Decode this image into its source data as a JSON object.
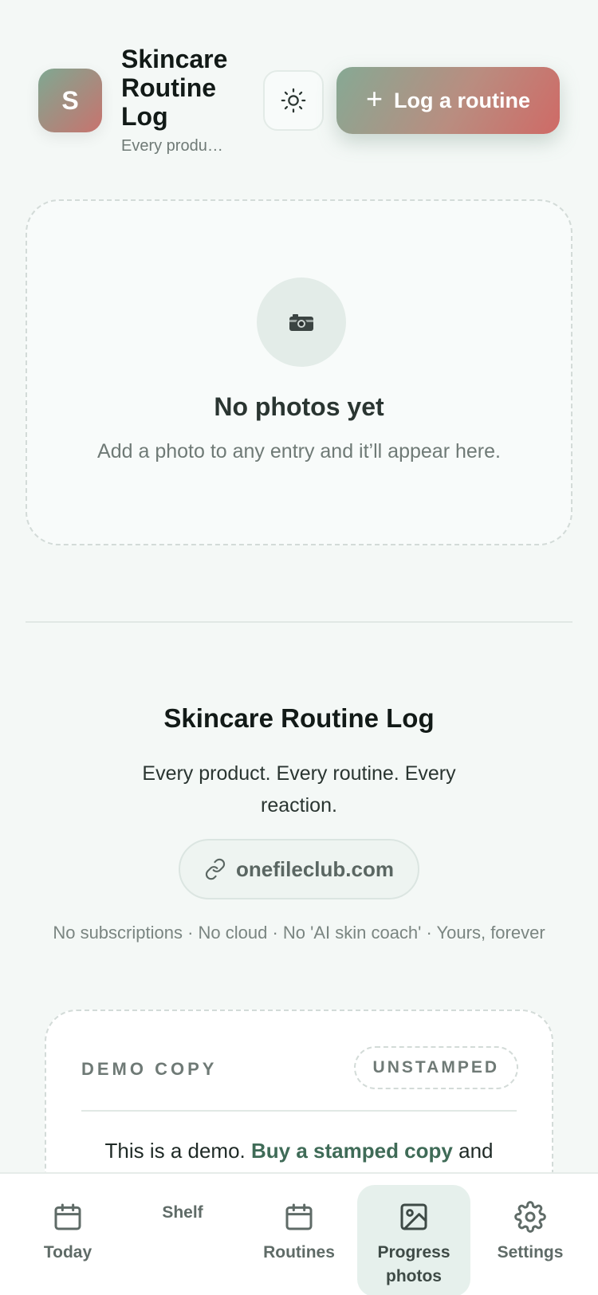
{
  "header": {
    "avatar_letter": "S",
    "title": "Skincare Routine Log",
    "subtitle": "Every produ…",
    "log_button_label": "Log a routine"
  },
  "empty_state": {
    "icon": "camera-icon",
    "title": "No photos yet",
    "description": "Add a photo to any entry and it’ll appear here."
  },
  "info": {
    "title": "Skincare Routine Log",
    "tagline": "Every product. Every routine. Every reaction.",
    "site": "onefileclub.com",
    "notes": "No subscriptions · No cloud · No 'AI skin coach' · Yours, forever"
  },
  "demo": {
    "label": "DEMO COPY",
    "badge": "UNSTAMPED",
    "text_before": "This is a demo.",
    "link_text": "Buy a stamped copy",
    "text_after": "and"
  },
  "nav": {
    "items": [
      {
        "label": "Today",
        "icon": "calendar-icon"
      },
      {
        "label": "Shelf",
        "icon": ""
      },
      {
        "label": "Routines",
        "icon": "calendar-icon"
      },
      {
        "label": "Progress photos",
        "icon": "image-icon",
        "active": true
      },
      {
        "label": "Settings",
        "icon": "gear-icon"
      }
    ]
  },
  "colors": {
    "accent_green": "#3f6b57",
    "gradient_start": "#86a994",
    "gradient_end": "#cf6a66",
    "background": "#f4f8f6"
  }
}
